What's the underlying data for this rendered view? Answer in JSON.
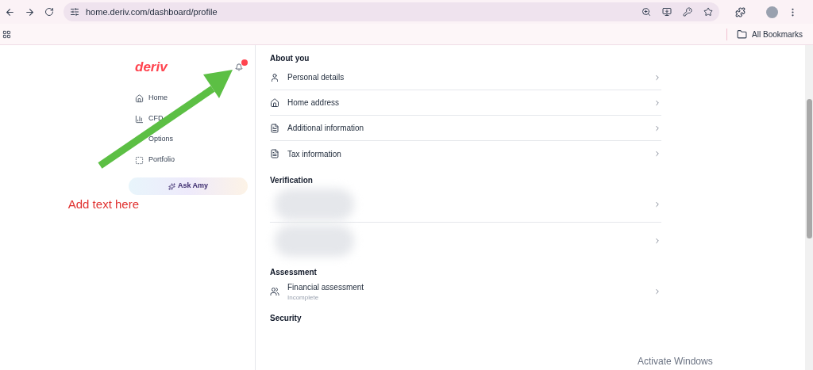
{
  "browser": {
    "url": "home.deriv.com/dashboard/profile",
    "bookmarks_label": "All Bookmarks"
  },
  "sidebar": {
    "logo": "deriv",
    "notifications": {
      "unread": true
    },
    "items": [
      {
        "label": "Home"
      },
      {
        "label": "CFD"
      },
      {
        "label": "Options"
      },
      {
        "label": "Portfolio"
      }
    ],
    "ask_button": "Ask Amy"
  },
  "annotation": {
    "text": "Add text here"
  },
  "sections": [
    {
      "title": "About you",
      "rows": [
        {
          "kind": "item",
          "label": "Personal details"
        },
        {
          "kind": "item",
          "label": "Home address"
        },
        {
          "kind": "item",
          "label": "Additional information"
        },
        {
          "kind": "item",
          "label": "Tax information"
        }
      ]
    },
    {
      "title": "Verification",
      "rows": [
        {
          "kind": "blurred"
        },
        {
          "kind": "blurred"
        }
      ]
    },
    {
      "title": "Assessment",
      "rows": [
        {
          "kind": "item",
          "label": "Financial assessment",
          "status": "Incomplete"
        }
      ]
    },
    {
      "title": "Security"
    }
  ],
  "os_notice": "Activate Windows"
}
